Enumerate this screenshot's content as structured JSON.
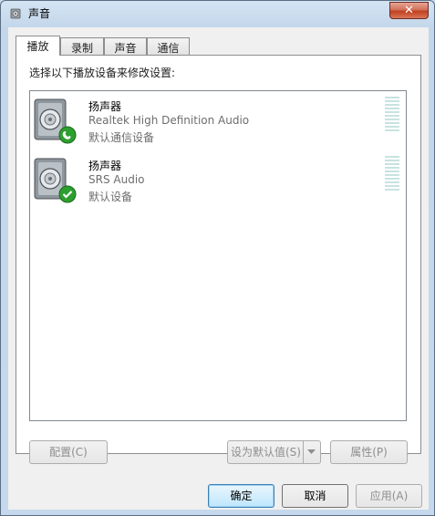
{
  "window": {
    "title": "声音",
    "close_glyph": "✕"
  },
  "tabs": [
    {
      "label": "播放",
      "active": true
    },
    {
      "label": "录制",
      "active": false
    },
    {
      "label": "声音",
      "active": false
    },
    {
      "label": "通信",
      "active": false
    }
  ],
  "panel": {
    "instruction": "选择以下播放设备来修改设置:"
  },
  "devices": [
    {
      "name": "扬声器",
      "driver": "Realtek High Definition Audio",
      "status": "默认通信设备",
      "badge": "phone-icon"
    },
    {
      "name": "扬声器",
      "driver": "SRS Audio",
      "status": "默认设备",
      "badge": "check-icon"
    }
  ],
  "buttons": {
    "configure": "配置(C)",
    "set_default": "设为默认值(S)",
    "properties": "属性(P)",
    "ok": "确定",
    "cancel": "取消",
    "apply": "应用(A)"
  },
  "colors": {
    "accent": "#3c7fb1",
    "badge_green": "#2d9f2f",
    "close_red": "#c0401f"
  }
}
